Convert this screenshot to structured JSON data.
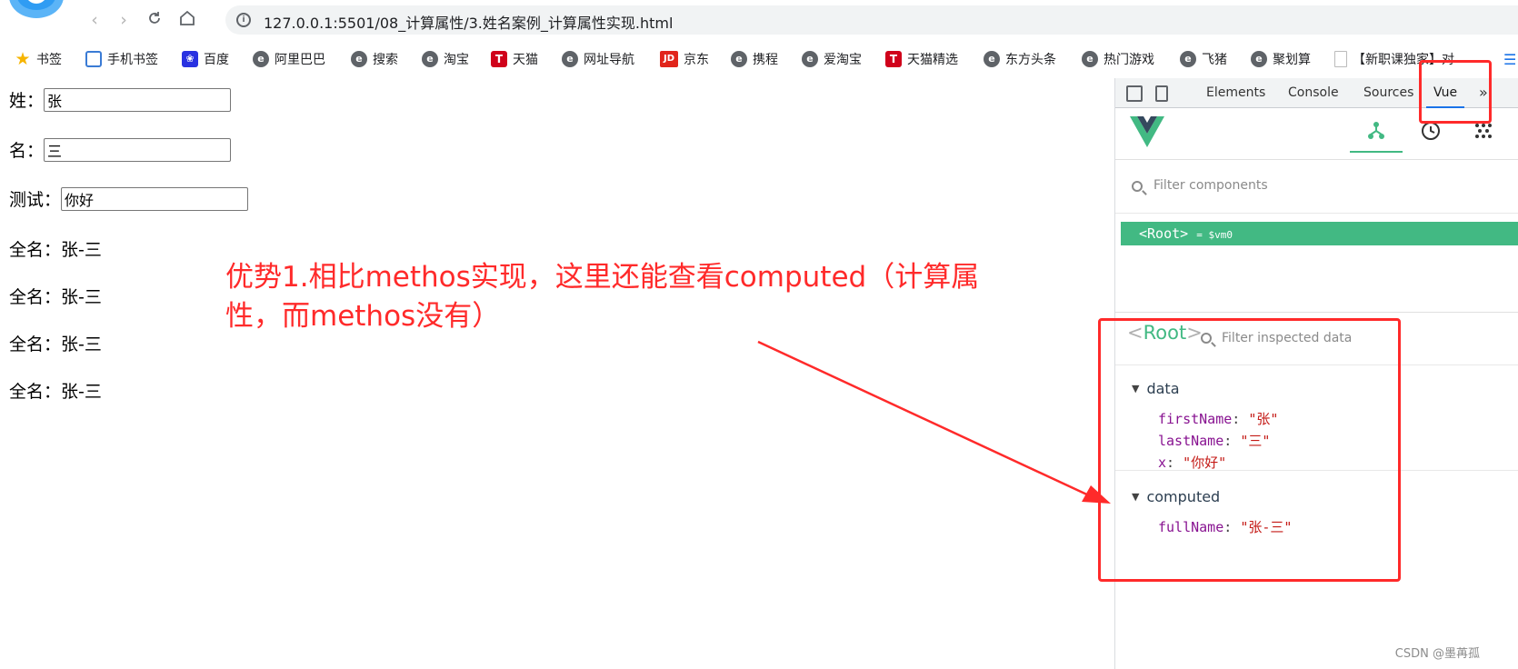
{
  "browser": {
    "url": "127.0.0.1:5501/08_计算属性/3.姓名案例_计算属性实现.html",
    "back_icon": "‹",
    "forward_icon": "›"
  },
  "bookmarks": [
    {
      "label": "书签",
      "icon": "star-icon"
    },
    {
      "label": "手机书签",
      "icon": "phone-icon"
    },
    {
      "label": "百度",
      "icon": "baidu-paw-icon"
    },
    {
      "label": "阿里巴巴",
      "icon": "e-icon"
    },
    {
      "label": "搜索",
      "icon": "e-icon"
    },
    {
      "label": "淘宝",
      "icon": "e-icon"
    },
    {
      "label": "天猫",
      "icon": "tmall-icon"
    },
    {
      "label": "网址导航",
      "icon": "e-icon"
    },
    {
      "label": "京东",
      "icon": "jd-icon"
    },
    {
      "label": "携程",
      "icon": "e-icon"
    },
    {
      "label": "爱淘宝",
      "icon": "e-icon"
    },
    {
      "label": "天猫精选",
      "icon": "tmall-icon"
    },
    {
      "label": "东方头条",
      "icon": "e-icon"
    },
    {
      "label": "热门游戏",
      "icon": "e-icon"
    },
    {
      "label": "飞猪",
      "icon": "e-icon"
    },
    {
      "label": "聚划算",
      "icon": "e-icon"
    },
    {
      "label": "【新职课独家】对",
      "icon": "page-icon"
    }
  ],
  "page": {
    "last_name_label": "姓：",
    "last_name_value": "张",
    "first_name_label": "名：",
    "first_name_value": "三",
    "test_label": "测试：",
    "test_value": "你好",
    "full_name_rows": [
      "全名：张-三",
      "全名：张-三",
      "全名：张-三",
      "全名：张-三"
    ]
  },
  "annotation": {
    "text": "优势1.相比methos实现，这里还能查看computed（计算属性，而methos没有）",
    "color": "#ff2a2a"
  },
  "devtools": {
    "tabs": [
      "Elements",
      "Console",
      "Sources",
      "Vue"
    ],
    "active_tab": "Vue",
    "more_icon": "»",
    "filter_components_placeholder": "Filter components",
    "root_label": "<Root>",
    "root_suffix": "= $vm0",
    "inspector": {
      "root_name": "Root",
      "filter_placeholder": "Filter inspected data",
      "data_section": "data",
      "computed_section": "computed",
      "data_props": [
        {
          "key": "firstName",
          "value": "\"张\""
        },
        {
          "key": "lastName",
          "value": "\"三\""
        },
        {
          "key": "x",
          "value": "\"你好\""
        }
      ],
      "computed_props": [
        {
          "key": "fullName",
          "value": "\"张-三\""
        }
      ]
    },
    "accent_color": "#42b983"
  },
  "watermark": "CSDN @墨苒孤"
}
